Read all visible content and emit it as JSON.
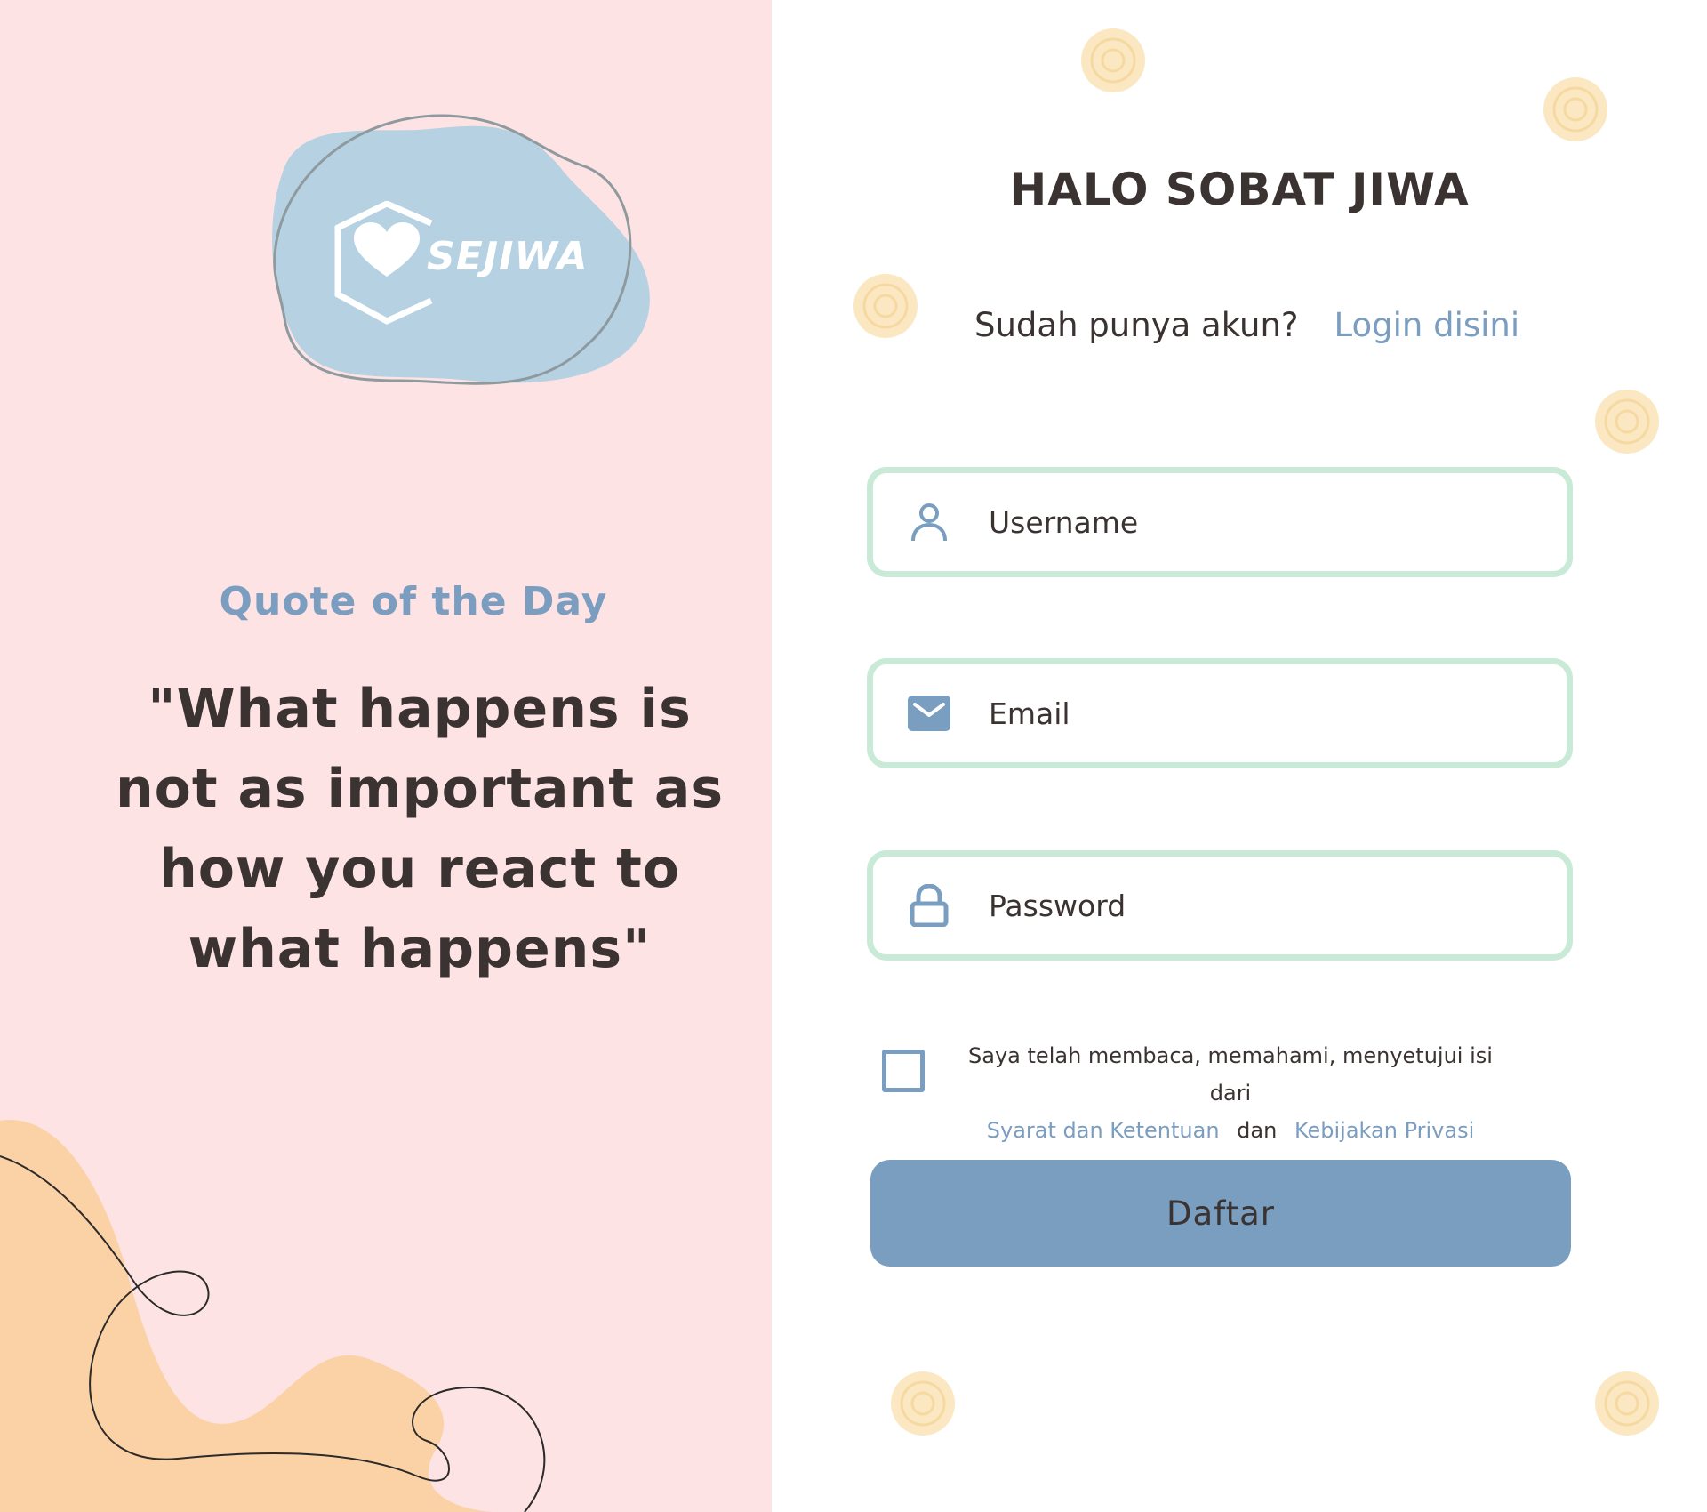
{
  "brand": {
    "logo_text": "SEJIWA"
  },
  "quote": {
    "title": "Quote of the Day",
    "text": "\"What happens is not as important as how you react to what happens\""
  },
  "form": {
    "heading": "HALO SOBAT JIWA",
    "login_prompt": "Sudah punya akun?",
    "login_link": "Login disini",
    "username_placeholder": "Username",
    "email_placeholder": "Email",
    "password_placeholder": "Password",
    "terms_prefix": "Saya telah membaca, memahami, menyetujui isi dari",
    "terms_link": "Syarat dan Ketentuan",
    "terms_and": "dan",
    "privacy_link": "Kebijakan Privasi",
    "submit_label": "Daftar"
  },
  "colors": {
    "left_bg": "#fde3e4",
    "accent_blue": "#799ebf",
    "field_border": "#c8ead6",
    "text_dark": "#3b3331",
    "blob_blue": "#b5d1e2",
    "blob_peach": "#fbd2a6",
    "dot_yellow": "#fbe8c2"
  },
  "icons": {
    "username": "user-icon",
    "email": "mail-icon",
    "password": "lock-icon",
    "logo": "heart-hexagon-icon"
  }
}
